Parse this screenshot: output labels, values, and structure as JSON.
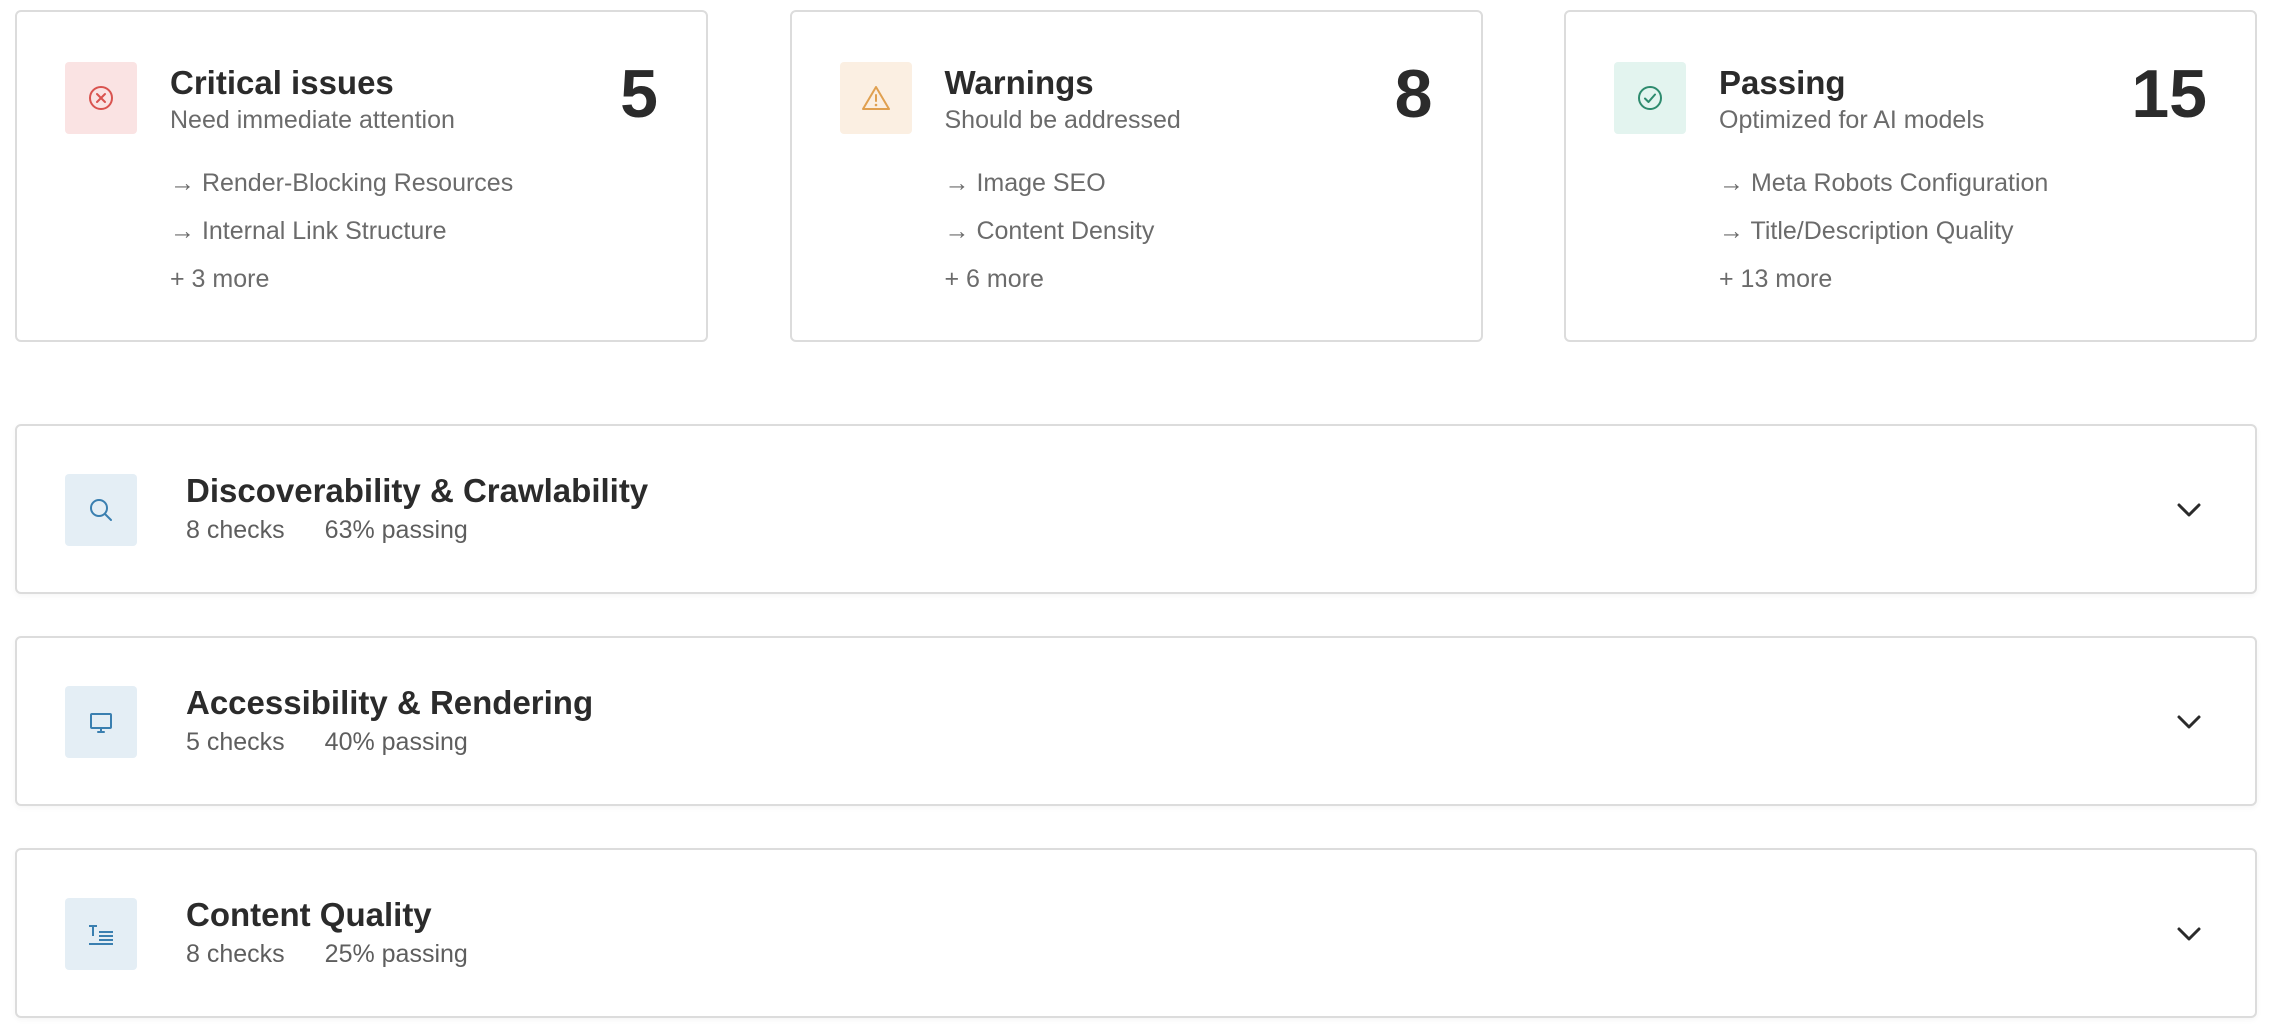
{
  "summary": [
    {
      "title": "Critical issues",
      "subtitle": "Need immediate attention",
      "count": "5",
      "items": [
        "→ Render-Blocking Resources",
        "→ Internal Link Structure"
      ],
      "more": "+ 3 more",
      "icon": "x-circle-icon",
      "icon_color": "#d9534f",
      "icon_bg": "#fae3e3"
    },
    {
      "title": "Warnings",
      "subtitle": "Should be addressed",
      "count": "8",
      "items": [
        "→ Image SEO",
        "→ Content Density"
      ],
      "more": "+ 6 more",
      "icon": "warning-triangle-icon",
      "icon_color": "#e0a050",
      "icon_bg": "#fbefe2"
    },
    {
      "title": "Passing",
      "subtitle": "Optimized for AI models",
      "count": "15",
      "items": [
        "→ Meta Robots Configuration",
        "→ Title/Description Quality"
      ],
      "more": "+ 13 more",
      "icon": "check-circle-icon",
      "icon_color": "#2e8b6e",
      "icon_bg": "#e3f4ef"
    }
  ],
  "categories": [
    {
      "title": "Discoverability & Crawlability",
      "checks": "8 checks",
      "passing": "63% passing",
      "icon": "search-icon"
    },
    {
      "title": "Accessibility & Rendering",
      "checks": "5 checks",
      "passing": "40% passing",
      "icon": "monitor-icon"
    },
    {
      "title": "Content Quality",
      "checks": "8 checks",
      "passing": "25% passing",
      "icon": "text-content-icon"
    }
  ],
  "colors": {
    "category_icon": "#3a7fb0",
    "category_icon_bg": "#e4eef5"
  }
}
